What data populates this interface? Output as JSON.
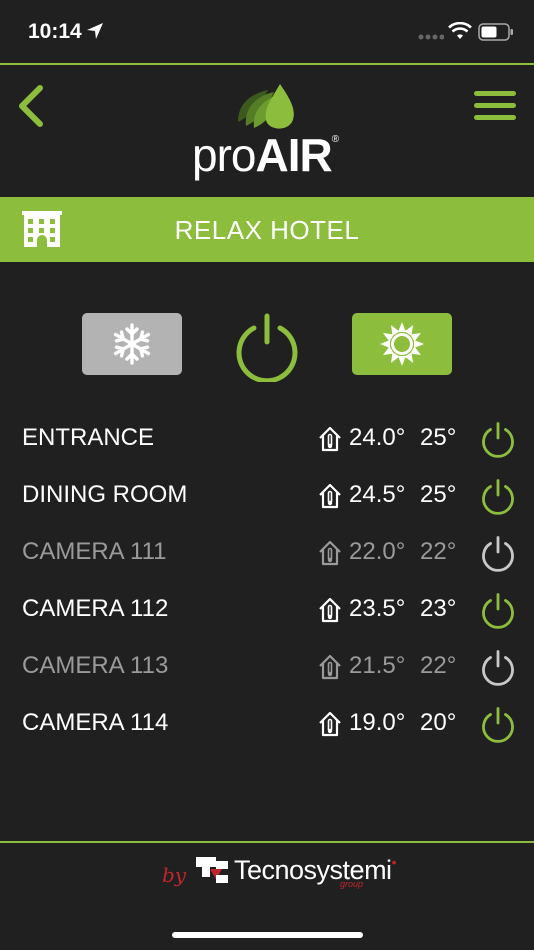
{
  "status_bar": {
    "time": "10:14"
  },
  "header": {
    "logo_pro": "pro",
    "logo_air": "AIR",
    "logo_reg": "®"
  },
  "hotel": {
    "name": "RELAX HOTEL"
  },
  "modes": {
    "active": "heat"
  },
  "rooms": [
    {
      "name": "ENTRANCE",
      "temp": "24.0°",
      "setpoint": "25°",
      "on": true
    },
    {
      "name": "DINING ROOM",
      "temp": "24.5°",
      "setpoint": "25°",
      "on": true
    },
    {
      "name": "CAMERA 111",
      "temp": "22.0°",
      "setpoint": "22°",
      "on": false
    },
    {
      "name": "CAMERA 112",
      "temp": "23.5°",
      "setpoint": "23°",
      "on": true
    },
    {
      "name": "CAMERA 113",
      "temp": "21.5°",
      "setpoint": "22°",
      "on": false
    },
    {
      "name": "CAMERA 114",
      "temp": "19.0°",
      "setpoint": "20°",
      "on": true
    }
  ],
  "footer": {
    "by": "by",
    "brand": "Tecnosystemi",
    "brand_dot": "•",
    "group": "group"
  },
  "colors": {
    "accent": "#8dbd3c",
    "background": "#202020",
    "inactive": "#9a9a9a",
    "brand_red": "#c0272d"
  }
}
